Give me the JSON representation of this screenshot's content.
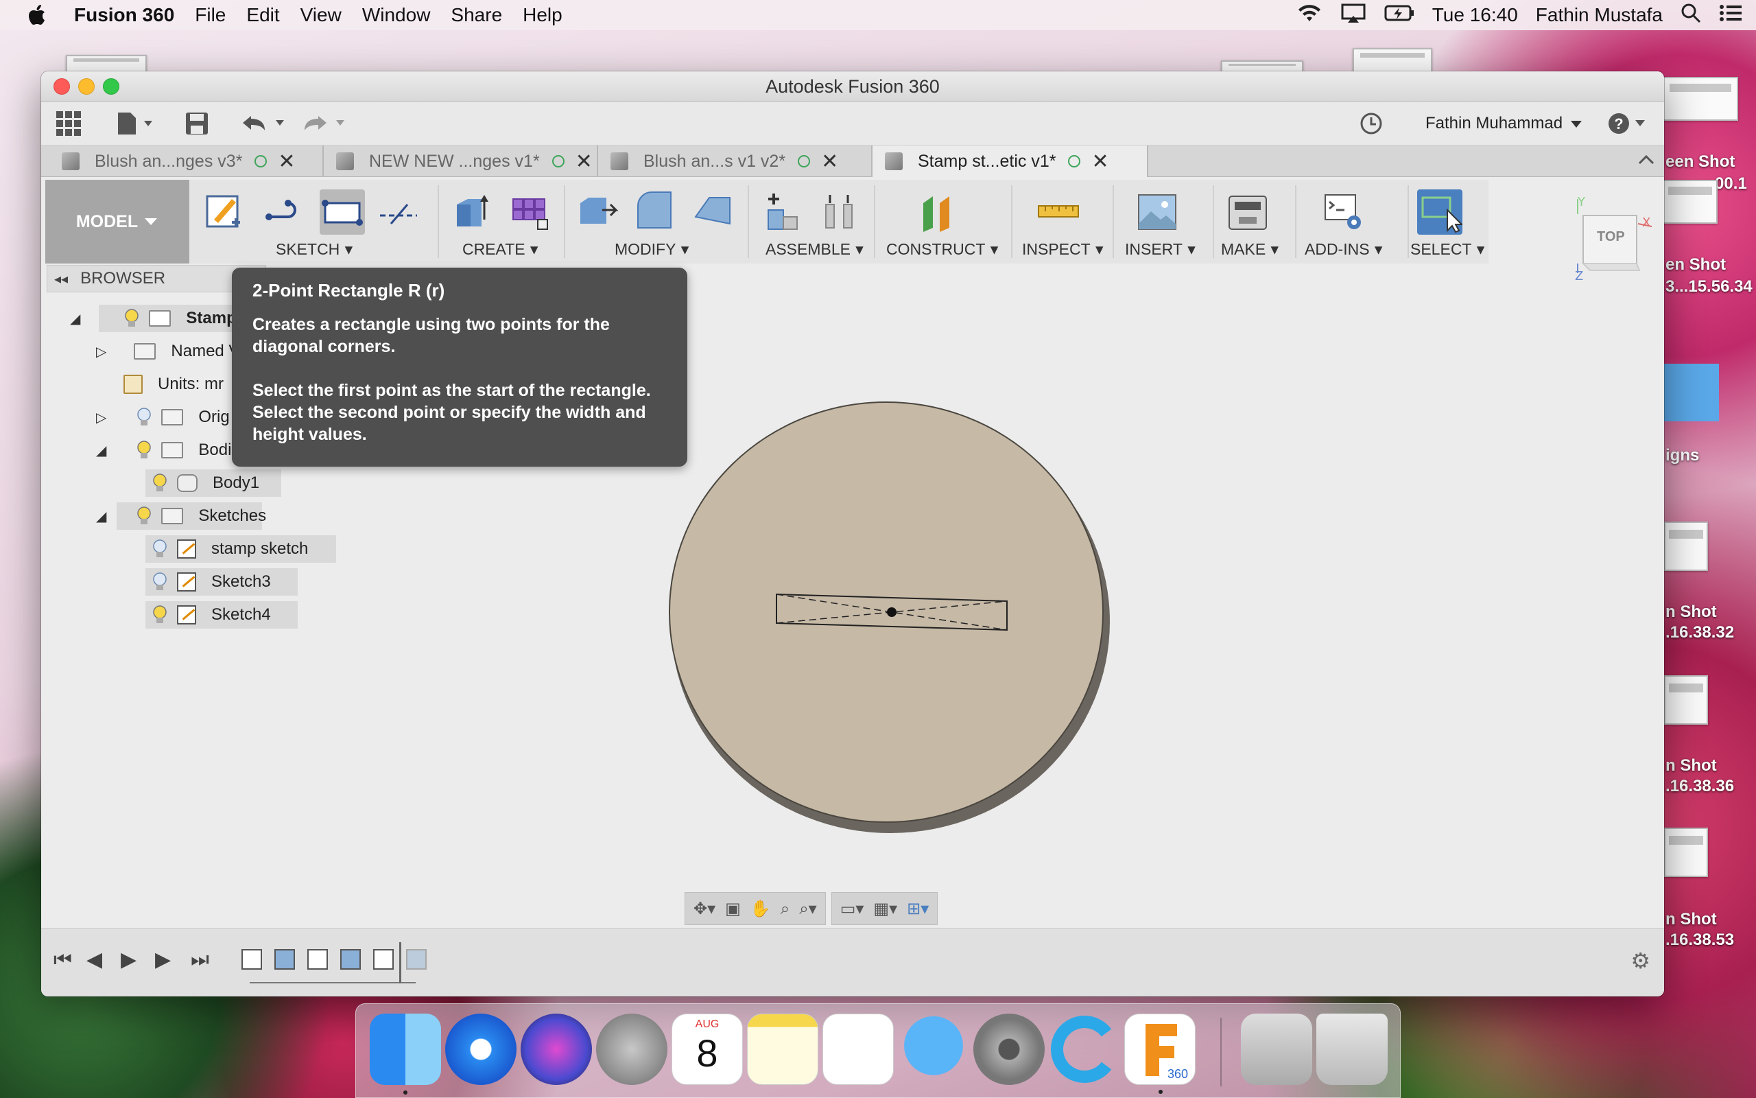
{
  "menubar": {
    "app_name": "Fusion 360",
    "menus": [
      "File",
      "Edit",
      "View",
      "Window",
      "Share",
      "Help"
    ],
    "clock": "Tue 16:40",
    "user": "Fathin Mustafa"
  },
  "desktop": {
    "labels": [
      "een Shot",
      "00.1",
      "en Shot",
      "3...15.56.34",
      "igns",
      "n Shot",
      ".16.38.32",
      "n Shot",
      ".16.38.36",
      "n Shot",
      ".16.38.53"
    ]
  },
  "window": {
    "title": "Autodesk Fusion 360",
    "user": "Fathin Muhammad",
    "tabs": [
      {
        "label": "Blush an...nges v3*"
      },
      {
        "label": "NEW NEW ...nges v1*"
      },
      {
        "label": "Blush an...s v1 v2*"
      },
      {
        "label": "Stamp st...etic v1*"
      }
    ],
    "workspace": "MODEL",
    "groups": [
      "SKETCH",
      "CREATE",
      "MODIFY",
      "ASSEMBLE",
      "CONSTRUCT",
      "INSPECT",
      "INSERT",
      "MAKE",
      "ADD-INS",
      "SELECT"
    ],
    "viewcube_label": "TOP"
  },
  "browser": {
    "header": "BROWSER",
    "nodes": {
      "root": "Stamp s",
      "named_views": "Named V",
      "units": "Units: mr",
      "origin": "Orig",
      "bodies": "Bodi",
      "body1": "Body1",
      "sketches": "Sketches",
      "stamp_sketch": "stamp sketch",
      "sketch3": "Sketch3",
      "sketch4": "Sketch4"
    }
  },
  "tooltip": {
    "title": "2-Point Rectangle R (r)",
    "line1": "Creates a rectangle using two points for the diagonal corners.",
    "line2": "Select the first point as the start of the rectangle. Select the second point or specify the width and height values."
  },
  "dock": {
    "calendar_month": "AUG",
    "calendar_day": "8",
    "fusion_badge": "360"
  },
  "colors": {
    "disc": "#c6b9a6",
    "disc_edge": "#8c8478",
    "tooltip_bg": "#4f4f4f",
    "select_blue": "#4a7fc0"
  }
}
